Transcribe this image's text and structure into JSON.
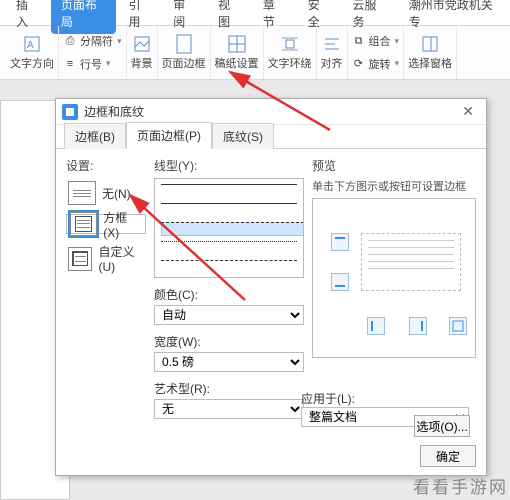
{
  "ribbon": {
    "tabs": [
      "插入",
      "页面布局",
      "引用",
      "审阅",
      "视图",
      "章节",
      "安全",
      "云服务",
      "潮州市党政机关专"
    ],
    "active_index": 1,
    "groups": {
      "text_direction": "文字方向",
      "separator": "分隔符",
      "line_number": "行号",
      "background": "背景",
      "page_border": "页面边框",
      "paper_setting": "稿纸设置",
      "text_wrap": "文字环绕",
      "align": "对齐",
      "group": "组合",
      "rotate": "旋转",
      "selection_pane": "选择窗格"
    }
  },
  "dialog": {
    "title": "边框和底纹",
    "tabs": {
      "border": "边框(B)",
      "page_border": "页面边框(P)",
      "shading": "底纹(S)"
    },
    "active_tab": "page_border",
    "settings_label": "设置:",
    "presets": {
      "none": "无(N)",
      "box": "方框(X)",
      "custom": "自定义(U)"
    },
    "selected_preset": "box",
    "linestyle_label": "线型(Y):",
    "color_label": "颜色(C):",
    "color_value": "自动",
    "width_label": "宽度(W):",
    "width_value": "0.5 磅",
    "art_label": "艺术型(R):",
    "art_value": "无",
    "preview_label": "预览",
    "preview_hint": "单击下方图示或按钮可设置边框",
    "apply_label": "应用于(L):",
    "apply_value": "整篇文档",
    "options_btn": "选项(O)...",
    "ok_btn": "确定"
  },
  "watermark": "看看手游网"
}
